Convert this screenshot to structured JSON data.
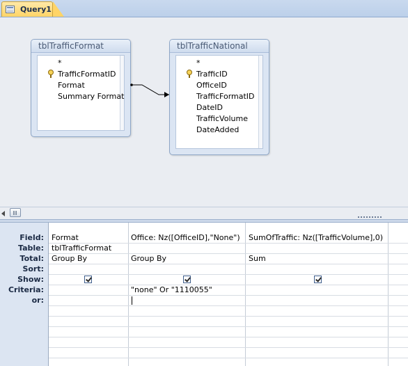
{
  "tab": {
    "label": "Query1",
    "icon": "query-icon"
  },
  "tables": [
    {
      "title": "tblTrafficFormat",
      "fields": [
        {
          "name": "*",
          "key": false
        },
        {
          "name": "TrafficFormatID",
          "key": true
        },
        {
          "name": "Format",
          "key": false
        },
        {
          "name": "Summary Format",
          "key": false
        }
      ]
    },
    {
      "title": "tblTrafficNational",
      "fields": [
        {
          "name": "*",
          "key": false
        },
        {
          "name": "TrafficID",
          "key": true
        },
        {
          "name": "OfficeID",
          "key": false
        },
        {
          "name": "TrafficFormatID",
          "key": false
        },
        {
          "name": "DateID",
          "key": false
        },
        {
          "name": "TrafficVolume",
          "key": false
        },
        {
          "name": "DateAdded",
          "key": false
        }
      ]
    }
  ],
  "relationship": {
    "from": "tblTrafficFormat.TrafficFormatID",
    "to": "tblTrafficNational.TrafficFormatID"
  },
  "grid": {
    "row_labels": [
      "Field:",
      "Table:",
      "Total:",
      "Sort:",
      "Show:",
      "Criteria:",
      "or:"
    ],
    "columns": [
      {
        "field": "Format",
        "table": "tblTrafficFormat",
        "total": "Group By",
        "sort": "",
        "show": true,
        "criteria": "",
        "or": ""
      },
      {
        "field": "Office: Nz([OfficeID],\"None\")",
        "table": "",
        "total": "Group By",
        "sort": "",
        "show": true,
        "criteria": "\"none\" Or \"1110055\"",
        "or": ""
      },
      {
        "field": "SumOfTraffic: Nz([TrafficVolume],0)",
        "table": "",
        "total": "Sum",
        "sort": "",
        "show": true,
        "criteria": "",
        "or": ""
      }
    ]
  },
  "colors": {
    "tab_active": "#ffd466",
    "designer_bg": "#eaedf2",
    "grid_label_bg": "#dce5f2",
    "table_header": "#cfdcee"
  }
}
